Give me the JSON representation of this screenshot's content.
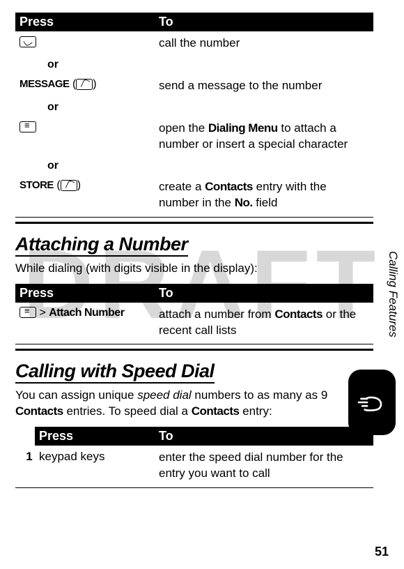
{
  "watermark": "DRAFT",
  "side_label": "Calling Features",
  "page_number": "51",
  "common": {
    "press_header": "Press",
    "to_header": "To",
    "or": "or",
    "gt": ">"
  },
  "table1": {
    "r1_to": "call the number",
    "r2_label": "MESSAGE",
    "r2_paren_open": "(",
    "r2_paren_close": ")",
    "r2_to": "send a message to the number",
    "r3_to_a": "open the ",
    "r3_bold": "Dialing Menu",
    "r3_to_b": " to attach a number or insert a special character",
    "r4_label": "STORE",
    "r4_paren_open": "(",
    "r4_paren_close": ")",
    "r4_to_a": "create a ",
    "r4_bold1": "Contacts",
    "r4_to_b": " entry with the number in the ",
    "r4_bold2": "No.",
    "r4_to_c": " field"
  },
  "section_attach": {
    "title": "Attaching a Number",
    "intro": "While dialing (with digits visible in the display):",
    "press_bold": "Attach Number",
    "to_a": "attach a number from ",
    "to_bold": "Contacts",
    "to_b": " or the recent call lists"
  },
  "section_speed": {
    "title": "Calling with Speed Dial",
    "intro_a": "You can assign unique ",
    "intro_italic": "speed dial",
    "intro_b": " numbers to as many as 9 ",
    "intro_bold": "Contacts",
    "intro_c": " entries. To speed dial a ",
    "intro_bold2": "Contacts",
    "intro_d": " entry:",
    "row_num": "1",
    "row_press": "keypad keys",
    "row_to": "enter the speed dial number for the entry you want to call"
  }
}
